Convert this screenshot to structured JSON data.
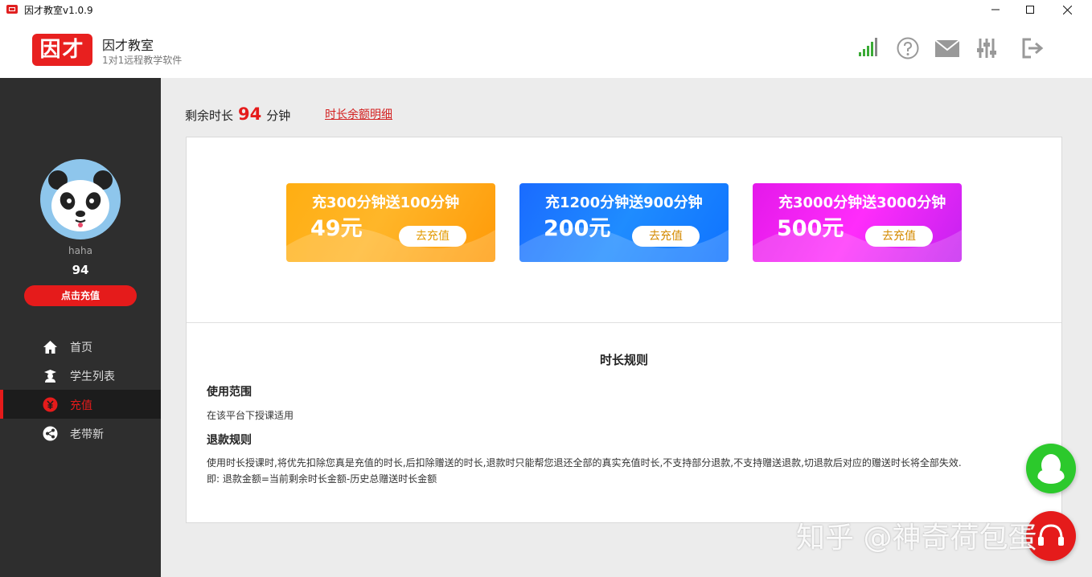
{
  "window": {
    "title": "因才教室v1.0.9"
  },
  "header": {
    "logo_text": "因才",
    "brand_name": "因才教室",
    "brand_subtitle": "1对1远程教学软件",
    "icons": [
      "signal-icon",
      "help-icon",
      "mail-icon",
      "settings-icon",
      "logout-icon"
    ]
  },
  "sidebar": {
    "username": "haha",
    "minutes": "94",
    "topup_label": "点击充值",
    "items": [
      {
        "label": "首页",
        "icon": "home-icon"
      },
      {
        "label": "学生列表",
        "icon": "student-icon"
      },
      {
        "label": "充值",
        "icon": "yuan-icon",
        "active": true
      },
      {
        "label": "老带新",
        "icon": "share-icon"
      }
    ]
  },
  "main": {
    "balance_label": "剩余时长",
    "balance_value": "94",
    "balance_unit": "分钟",
    "detail_link": "时长余额明细",
    "packages": [
      {
        "title": "充300分钟送100分钟",
        "price": "49元",
        "button": "去充值",
        "color": "#ffae12"
      },
      {
        "title": "充1200分钟送900分钟",
        "price": "200元",
        "button": "去充值",
        "color": "#1a6bff"
      },
      {
        "title": "充3000分钟送3000分钟",
        "price": "500元",
        "button": "去充值",
        "color": "#e419ea"
      }
    ],
    "rules": {
      "title": "时长规则",
      "scope_heading": "使用范围",
      "scope_text": "在该平台下授课适用",
      "refund_heading": "退款规则",
      "refund_text_1": "使用时长授课时,将优先扣除您真是充值的时长,后扣除赠送的时长,退款时只能帮您退还全部的真实充值时长,不支持部分退款,不支持赠送退款,切退款后对应的赠送时长将全部失效.",
      "refund_text_2": "即: 退款金额=当前剩余时长金额-历史总赠送时长金额"
    }
  },
  "watermark": "知乎 @神奇荷包蛋",
  "colors": {
    "accent": "#e51b1b",
    "sidebar_bg": "#2e2e2e",
    "main_bg": "#ececec",
    "fab_green": "#2cc92c"
  }
}
